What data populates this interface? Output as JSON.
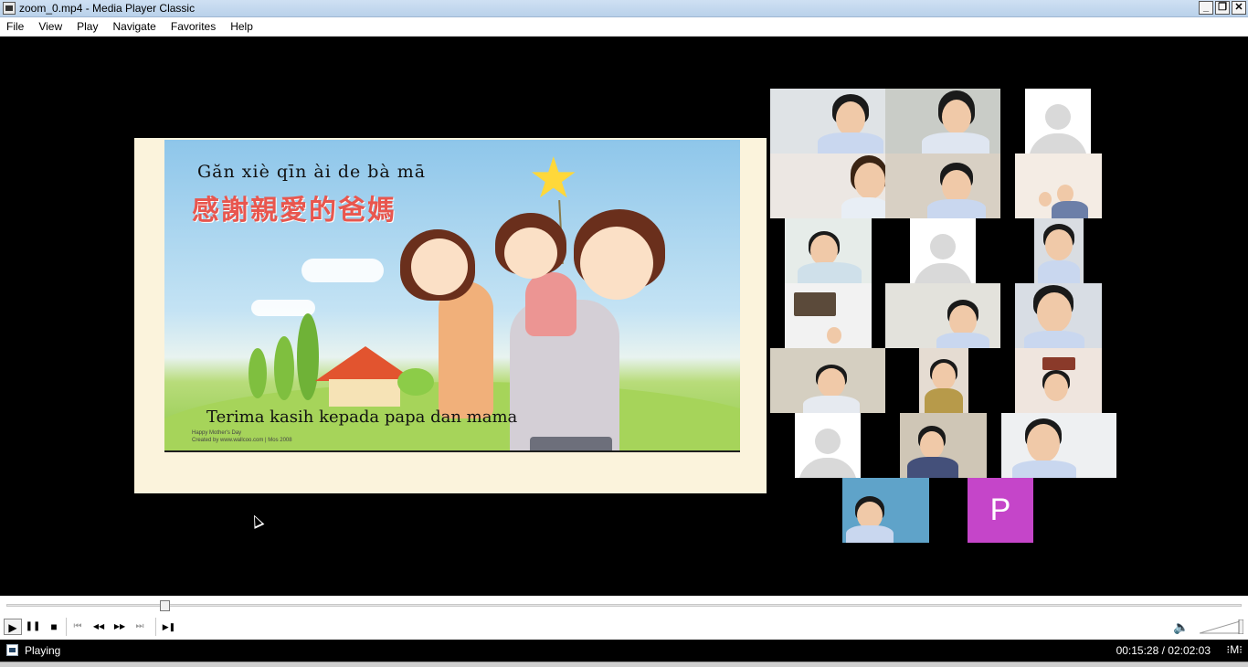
{
  "window": {
    "title": "zoom_0.mp4 - Media Player Classic",
    "minimize": "_",
    "restore": "❐",
    "close": "✕"
  },
  "menu": [
    "File",
    "View",
    "Play",
    "Navigate",
    "Favorites",
    "Help"
  ],
  "slide": {
    "pinyin": "Găn xiè qīn ài de bà mā",
    "chinese": "感謝親愛的爸媽",
    "malay": "Terima kasih kepada papa dan mama",
    "credit_line1": "Happy Mother's Day",
    "credit_line2": "Created by www.wallcoo.com | Mos 2008"
  },
  "gallery": {
    "participant_initial": "P",
    "accent": "#c545c9"
  },
  "playback": {
    "progress_fraction": 0.1276,
    "volume_fraction": 1.0
  },
  "controls": {
    "play": "▶",
    "pause": "❚❚",
    "stop": "■",
    "prev": "⏮",
    "rewind": "◀◀",
    "forward": "▶▶",
    "next": "⏭",
    "frame_step": "▶❚",
    "volume_icon": "🔈"
  },
  "status": {
    "state": "Playing",
    "time": "00:15:28 / 02:02:03",
    "extra": "⁝M⁝"
  }
}
